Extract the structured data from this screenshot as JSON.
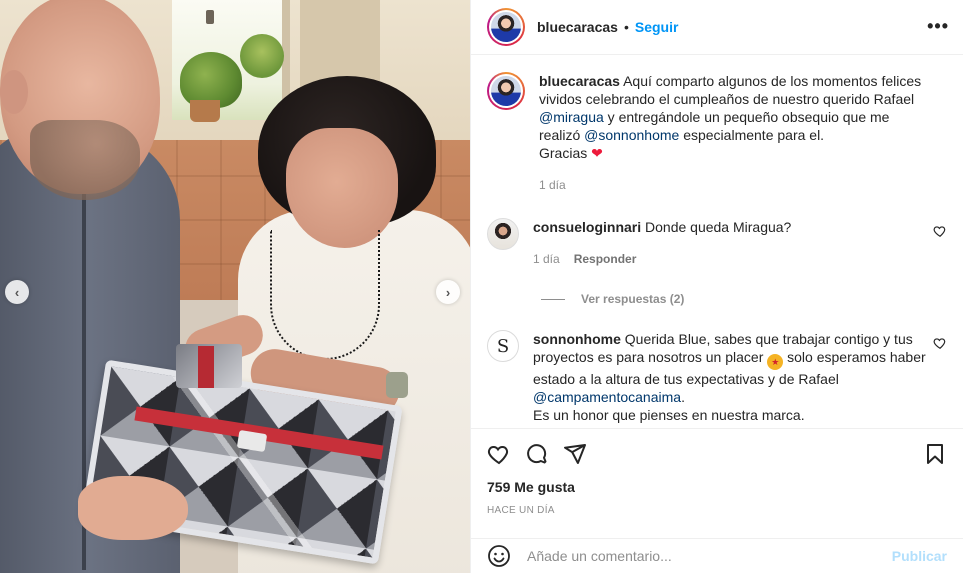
{
  "post": {
    "author": "bluecaracas",
    "separator": "•",
    "follow_label": "Seguir",
    "more_label": "•••"
  },
  "caption": {
    "username": "bluecaracas",
    "text_1": "Aquí comparto algunos de los momentos felices vividos celebrando el cumpleaños de nuestro querido Rafael ",
    "mention_1": "@miragua",
    "text_2": " y entregándole un pequeño obsequio que me realizó ",
    "mention_2": "@sonnonhome",
    "text_3": " especialmente para el.",
    "thanks": "Gracias",
    "thanks_emoji": "❤",
    "time": "1 día"
  },
  "comments": [
    {
      "username": "consueloginnari",
      "text": "Donde queda Miragua?",
      "time": "1 día",
      "reply_label": "Responder",
      "view_replies": "Ver respuestas (2)"
    },
    {
      "username": "sonnonhome",
      "avatar_letter": "S",
      "text_1": "Querida Blue, sabes que trabajar contigo y tus proyectos es para nosotros un placer ",
      "text_2": " solo esperamos haber estado a la altura de tus expectativas y de Rafael ",
      "mention": "@campamentocanaima",
      "text_3": ".",
      "text_4": "Es un honor que pienses en nuestra marca."
    }
  ],
  "engagement": {
    "likes": "759 Me gusta",
    "posted": "Hace un día"
  },
  "composer": {
    "placeholder": "Añade un comentario...",
    "publish_label": "Publicar"
  },
  "carousel": {
    "prev": "‹",
    "next": "›"
  },
  "colors": {
    "accent": "#0095f6",
    "mention": "#00376b",
    "publish_disabled": "#b2dffc",
    "heart": "#ed1a3b"
  }
}
